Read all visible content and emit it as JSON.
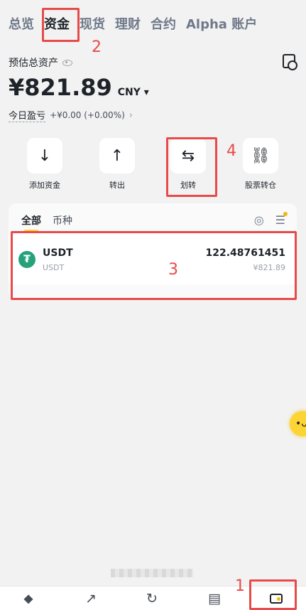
{
  "tabs": [
    "总览",
    "资金",
    "现货",
    "理财",
    "合约",
    "Alpha 账户"
  ],
  "summary": {
    "est_label": "预估总资产",
    "amount": "¥821.89",
    "currency": "CNY ▾",
    "pnl_label": "今日盈亏",
    "pnl_value": "+¥0.00 (+0.00%)",
    "pnl_arrow": "›"
  },
  "actions": [
    {
      "label": "添加资金",
      "icon": "↓",
      "icon_name": "arrow-down-icon"
    },
    {
      "label": "转出",
      "icon": "↑",
      "icon_name": "arrow-up-icon"
    },
    {
      "label": "划转",
      "icon": "⇆",
      "icon_name": "transfer-arrows-icon"
    },
    {
      "label": "股票转仓",
      "icon": "⛓",
      "icon_name": "stock-transfer-icon"
    }
  ],
  "card": {
    "tab_all": "全部",
    "tab_coin": "币种",
    "assets": [
      {
        "name": "USDT",
        "sub": "USDT",
        "amount": "122.48761451",
        "value": "¥821.89",
        "coin_symbol": "₮"
      }
    ]
  },
  "annotations": [
    "2",
    "3",
    "4",
    "1"
  ],
  "colors": {
    "accent": "#fcd535",
    "annotation": "#e84a4a",
    "usdt": "#26a17b"
  },
  "bottom_nav": [
    {
      "icon": "⬥",
      "icon_name": "binance-logo-icon"
    },
    {
      "icon": "↗",
      "icon_name": "markets-chart-icon"
    },
    {
      "icon": "↻",
      "icon_name": "trade-icon"
    },
    {
      "icon": "▤",
      "icon_name": "futures-icon"
    },
    {
      "icon": "",
      "icon_name": "wallet-icon"
    }
  ]
}
